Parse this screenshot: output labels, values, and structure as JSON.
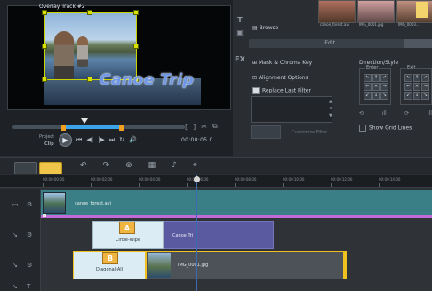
{
  "preview": {
    "overlay_label": "Overlay Track #2",
    "title_text": "Canoe Trip",
    "project_label": "Project",
    "clip_label": "Clip",
    "timecode": "00:00:05 0",
    "top_icons": [
      "[",
      "]",
      "✂",
      "⧉"
    ],
    "transport": [
      "⏮",
      "◀|",
      "|▶",
      "⏭",
      "↻",
      "🔊"
    ]
  },
  "options": {
    "browse_label": "Browse",
    "thumbs": [
      "canoe_forest.avi",
      "IMG_0001.jpg",
      "IMG_0003..."
    ],
    "edit_tab": "Edit",
    "mask_label": "Mask & Chroma Key",
    "alignment_label": "Alignment Options",
    "replace_filter_label": "Replace Last Filter",
    "custom_filter_label": "Customize Filter",
    "direction_label": "Direction/Style",
    "enter_label": "Enter",
    "exit_label": "Exit",
    "show_grid_label": "Show Grid Lines"
  },
  "ruler": {
    "ticks": [
      "00:00:00:00",
      "00:00:02:00",
      "00:00:04:00",
      "00:00:06:00",
      "00:00:08:00",
      "00:00:10:00",
      "00:00:12:00",
      "00:00:14:00"
    ]
  },
  "tracks": {
    "video_clip": "canoe_forest.avi",
    "overlay1_transition": "Circle-Wipe",
    "overlay1_transition_letter": "A",
    "overlay1_clip": "Canoe Tri",
    "overlay2_transition": "Diagonal-All",
    "overlay2_transition_letter": "B",
    "overlay2_clip": "IMG_0001.jpg"
  },
  "colors": {
    "accent": "#f0c64a",
    "video_track": "#3b7f86",
    "overlay_clip": "#5a5aa0",
    "title": "#6f97e6"
  }
}
